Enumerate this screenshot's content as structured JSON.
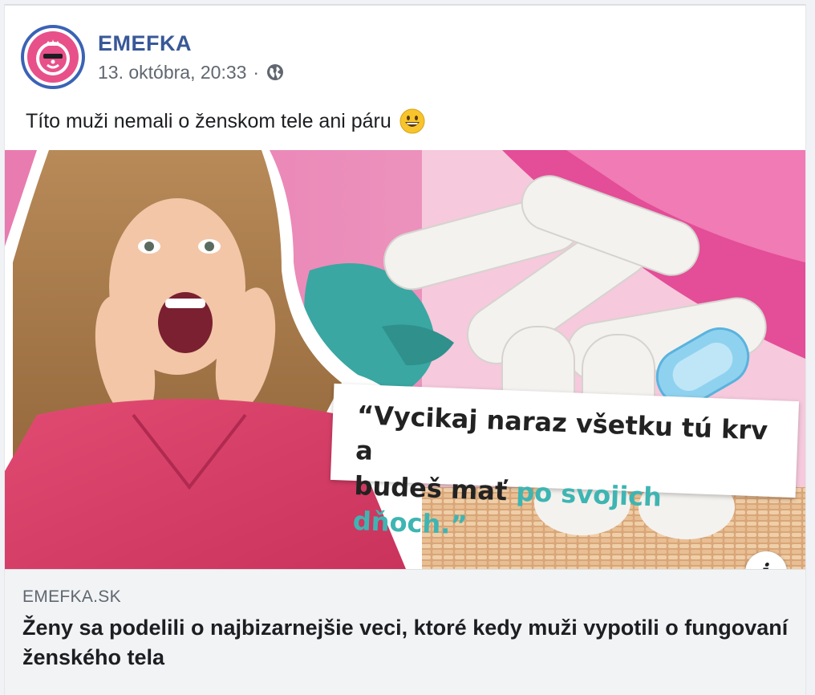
{
  "post": {
    "page_name": "EMEFKA",
    "timestamp": "13. októbra, 20:33",
    "separator": "·",
    "privacy_icon": "globe-icon",
    "text": "Títo muži nemali o ženskom tele ani páru",
    "emoji": "grinning-face-emoji"
  },
  "link": {
    "image_quote_line1": "“Vycikaj naraz všetku tú krv a",
    "image_quote_line2_start": "budeš mať ",
    "image_quote_line2_accent": "po svojich dňoch.”",
    "info_label": "i",
    "domain": "EMEFKA.SK",
    "headline": "Ženy sa podelili o najbizarnejšie veci, ktoré kedy muži vypotili o fungovaní ženského tela"
  },
  "colors": {
    "page_name": "#385898",
    "avatar_ring": "#3b62b5",
    "avatar_fill": "#e8508a",
    "quote_accent": "#3eb5b2",
    "footer_bg": "#f2f3f5"
  }
}
